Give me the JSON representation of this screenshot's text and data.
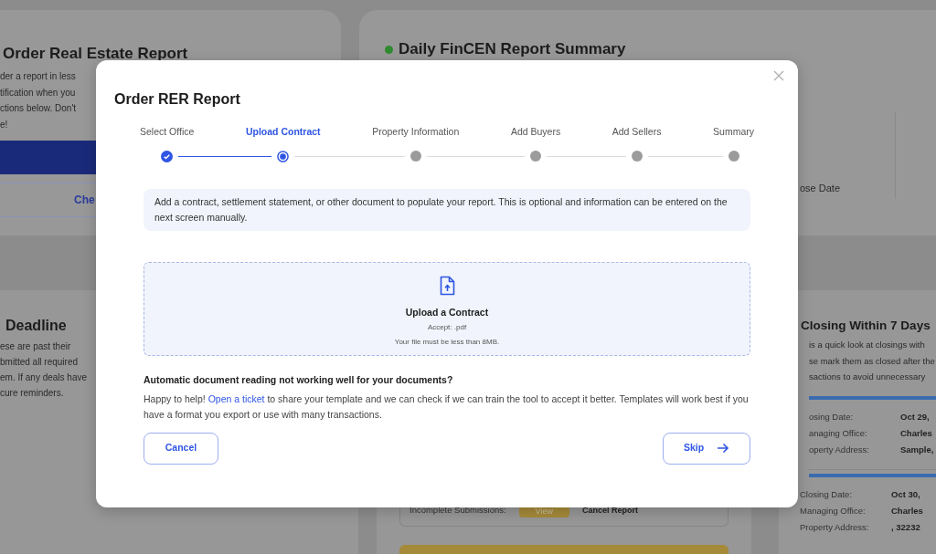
{
  "background": {
    "real_estate_card": {
      "title": "Order Real Estate Report",
      "lines": [
        "der a report in less",
        "tification when you",
        "ctions below. Don't",
        "e!"
      ],
      "link": "Che"
    },
    "fincen_card": {
      "title": "Daily FinCEN Report Summary",
      "column_label": "ose Date",
      "row_label": "Incomplete Submissions:",
      "view_button": "View",
      "cancel_link": "Cancel Report"
    },
    "deadline_card": {
      "title": "Deadline",
      "lines": [
        "ese are past their",
        "bmitted all required",
        "em. If any deals have",
        "cure reminders."
      ]
    },
    "closing_card": {
      "title": "Closing Within 7 Days",
      "lines": [
        "is a quick look at closings with",
        "se mark them as closed after the",
        "sactions to avoid unnecessary"
      ],
      "entries": [
        {
          "rows": [
            {
              "label": "osing Date:",
              "value": "Oct 29,"
            },
            {
              "label": "anaging Office:",
              "value": "Charles"
            },
            {
              "label": "operty Address:",
              "value": "Sample,"
            }
          ]
        },
        {
          "rows": [
            {
              "label": "Closing Date:",
              "value": "Oct 30,"
            },
            {
              "label": "Managing Office:",
              "value": "Charles"
            },
            {
              "label": "Property Address:",
              "value": ", 32232"
            }
          ]
        }
      ]
    }
  },
  "modal": {
    "title": "Order RER Report",
    "steps": [
      {
        "label": "Select Office",
        "completed": true,
        "selected": false
      },
      {
        "label": "Upload Contract",
        "completed": false,
        "selected": true
      },
      {
        "label": "Property Information",
        "completed": false,
        "selected": false
      },
      {
        "label": "Add Buyers",
        "completed": false,
        "selected": false
      },
      {
        "label": "Add Sellers",
        "completed": false,
        "selected": false
      },
      {
        "label": "Summary",
        "completed": false,
        "selected": false
      }
    ],
    "info": "Add a contract, settlement statement, or other document to populate your report. This is optional and information can be entered on the next screen manually.",
    "upload": {
      "title": "Upload a Contract",
      "accept": "Accept: .pdf",
      "limit": "Your file must be less than 8MB."
    },
    "help": {
      "heading": "Automatic document reading not working well for your documents?",
      "before": "Happy to help! ",
      "link": "Open a ticket",
      "after": " to share your template and we can check if we can train the tool to accept it better. Templates will work best if you have a format you export or use with many transactions."
    },
    "buttons": {
      "cancel": "Cancel",
      "skip": "Skip"
    }
  }
}
